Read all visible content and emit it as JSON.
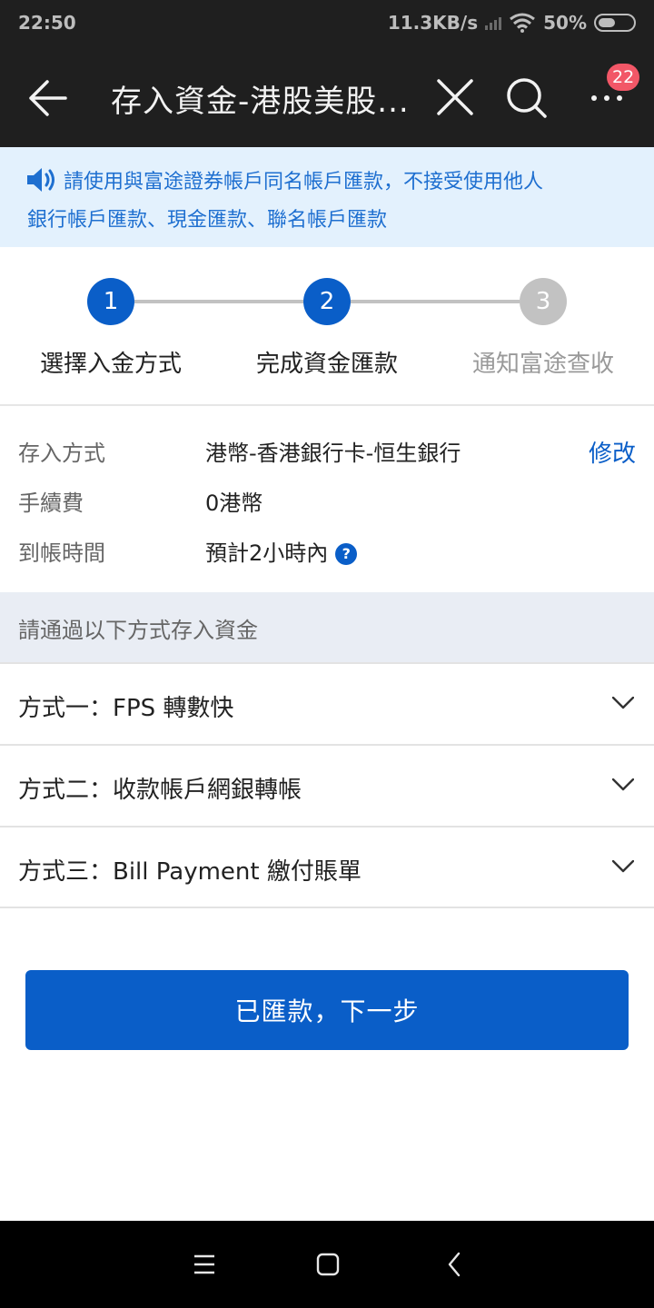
{
  "status_bar": {
    "time": "22:50",
    "network_speed": "11.3KB/s",
    "battery_percent": "50%",
    "battery_level": 0.5,
    "icons": [
      "signal-icon",
      "wifi-icon",
      "battery-icon"
    ]
  },
  "nav": {
    "title": "存入資金-港股美股...",
    "badge_count": "22",
    "icons": [
      "back-arrow-icon",
      "close-icon",
      "search-icon",
      "more-icon"
    ]
  },
  "notice": {
    "line1": "請使用與富途證券帳戶同名帳戶匯款，不接受使用他人",
    "line2": "銀行帳戶匯款、現金匯款、聯名帳戶匯款",
    "icon": "speaker-icon"
  },
  "steps": [
    {
      "number": "1",
      "label": "選擇入金方式",
      "state": "active"
    },
    {
      "number": "2",
      "label": "完成資金匯款",
      "state": "active"
    },
    {
      "number": "3",
      "label": "通知富途查收",
      "state": "inactive"
    }
  ],
  "info": {
    "method_label": "存入方式",
    "method_value": "港幣-香港銀行卡-恒生銀行",
    "edit_label": "修改",
    "fee_label": "手續費",
    "fee_value": "0港幣",
    "time_label": "到帳時間",
    "time_value": "預計2小時內",
    "help_icon": "?"
  },
  "section_header": "請通過以下方式存入資金",
  "methods": [
    {
      "label": "方式一：FPS 轉數快"
    },
    {
      "label": "方式二：收款帳戶網銀轉帳"
    },
    {
      "label": "方式三：Bill Payment 繳付賬單"
    }
  ],
  "primary_button": "已匯款，下一步",
  "colors": {
    "accent": "#0a5ec8",
    "nav_bg": "#1f1f1f",
    "notice_bg": "#e3f1fd",
    "notice_text": "#1e6fd0",
    "badge": "#f25767",
    "step_inactive": "#c2c2c2",
    "section_bg": "#e9edf4"
  }
}
